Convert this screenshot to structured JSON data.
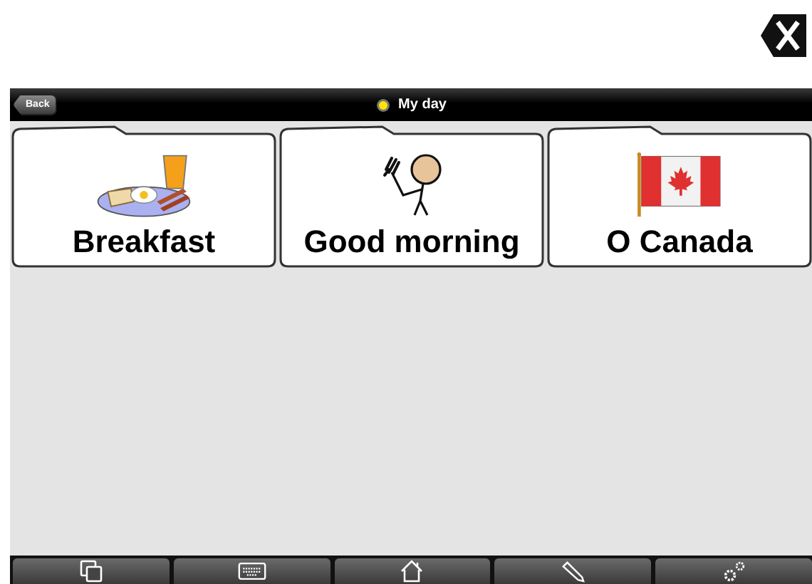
{
  "header": {
    "back_button": "Back",
    "title": "My day"
  },
  "tiles": [
    {
      "label": "Breakfast"
    },
    {
      "label": "Good morning"
    },
    {
      "label": "O Canada"
    }
  ]
}
